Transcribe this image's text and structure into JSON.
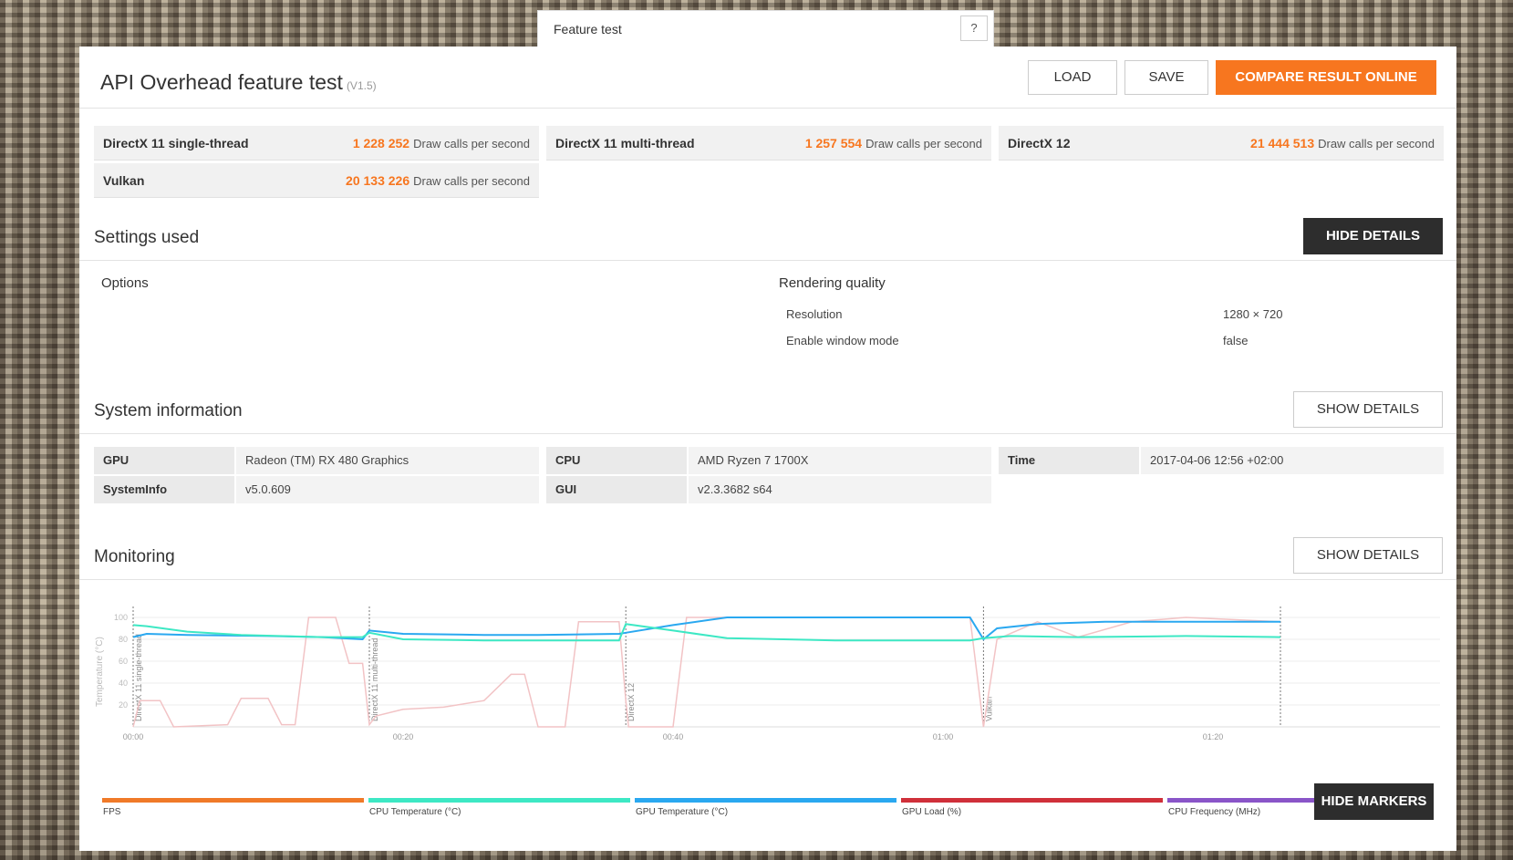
{
  "window": {
    "title": "Feature test",
    "help": "?"
  },
  "header": {
    "title": "API Overhead feature test",
    "version": "(V1.5)"
  },
  "toolbar": {
    "load": "LOAD",
    "save": "SAVE",
    "compare": "COMPARE RESULT ONLINE"
  },
  "scores": [
    {
      "name": "DirectX 11 single-thread",
      "value": "1 228 252",
      "unit": "Draw calls per second"
    },
    {
      "name": "DirectX 11 multi-thread",
      "value": "1 257 554",
      "unit": "Draw calls per second"
    },
    {
      "name": "DirectX 12",
      "value": "21 444 513",
      "unit": "Draw calls per second"
    },
    {
      "name": "Vulkan",
      "value": "20 133 226",
      "unit": "Draw calls per second"
    }
  ],
  "settings": {
    "title": "Settings used",
    "button": "HIDE DETAILS",
    "options_label": "Options",
    "rendering_label": "Rendering quality",
    "rows": [
      {
        "key": "Resolution",
        "value": "1280 × 720"
      },
      {
        "key": "Enable window mode",
        "value": "false"
      }
    ]
  },
  "sysinfo": {
    "title": "System information",
    "button": "SHOW DETAILS",
    "rows": [
      {
        "key": "GPU",
        "value": "Radeon (TM) RX 480 Graphics"
      },
      {
        "key": "CPU",
        "value": "AMD Ryzen 7 1700X"
      },
      {
        "key": "Time",
        "value": "2017-04-06 12:56 +02:00"
      },
      {
        "key": "SystemInfo",
        "value": "v5.0.609"
      },
      {
        "key": "GUI",
        "value": "v2.3.3682 s64"
      }
    ]
  },
  "monitoring": {
    "title": "Monitoring",
    "button": "SHOW DETAILS",
    "markers_button": "HIDE MARKERS",
    "legend": [
      {
        "label": "FPS",
        "color": "#f07a28"
      },
      {
        "label": "CPU Temperature (°C)",
        "color": "#3de8c4"
      },
      {
        "label": "GPU Temperature (°C)",
        "color": "#2aa8f0"
      },
      {
        "label": "GPU Load (%)",
        "color": "#d0303a"
      },
      {
        "label": "CPU Frequency (MHz)",
        "color": "#8a55c8"
      }
    ]
  },
  "chart_data": {
    "type": "line",
    "ylabel": "Temperature (°C)",
    "ylim": [
      0,
      100
    ],
    "yticks": [
      "100",
      "80",
      "60",
      "40",
      "20"
    ],
    "xticks": [
      "00:00",
      "00:20",
      "00:40",
      "01:00",
      "01:20"
    ],
    "markers": [
      {
        "label": "DirectX 11 single-thread",
        "t": 0
      },
      {
        "label": "DirectX 11 multi-thread",
        "t": 17.5
      },
      {
        "label": "DirectX 12",
        "t": 36.5
      },
      {
        "label": "Vulkan",
        "t": 63
      },
      {
        "end": 85
      }
    ],
    "series": [
      {
        "name": "CPU Temperature (°C)",
        "color": "#3de8c4",
        "points": [
          [
            0,
            93
          ],
          [
            1,
            92
          ],
          [
            4,
            87
          ],
          [
            8,
            84
          ],
          [
            14,
            82
          ],
          [
            17,
            82
          ],
          [
            17.5,
            86
          ],
          [
            20,
            80
          ],
          [
            26,
            79
          ],
          [
            32,
            79
          ],
          [
            36,
            79
          ],
          [
            36.5,
            94
          ],
          [
            40,
            88
          ],
          [
            44,
            81
          ],
          [
            52,
            79
          ],
          [
            62,
            79
          ],
          [
            63,
            81
          ],
          [
            65,
            83
          ],
          [
            70,
            82
          ],
          [
            78,
            83
          ],
          [
            85,
            82
          ]
        ]
      },
      {
        "name": "GPU Temperature (°C)",
        "color": "#2aa8f0",
        "points": [
          [
            0,
            82
          ],
          [
            1,
            85
          ],
          [
            4,
            84
          ],
          [
            10,
            83
          ],
          [
            14,
            82
          ],
          [
            17,
            80
          ],
          [
            17.5,
            88
          ],
          [
            20,
            85
          ],
          [
            26,
            84
          ],
          [
            30,
            84
          ],
          [
            36,
            85
          ],
          [
            36.5,
            86
          ],
          [
            40,
            93
          ],
          [
            44,
            100
          ],
          [
            62,
            100
          ],
          [
            63,
            80
          ],
          [
            64,
            90
          ],
          [
            67,
            94
          ],
          [
            72,
            96
          ],
          [
            85,
            96
          ]
        ]
      },
      {
        "name": "GPU Load (%)",
        "color": "#f2c3c5",
        "points": [
          [
            0,
            0
          ],
          [
            0.5,
            24
          ],
          [
            2,
            24
          ],
          [
            3,
            0
          ],
          [
            7,
            2
          ],
          [
            8,
            26
          ],
          [
            10,
            26
          ],
          [
            11,
            2
          ],
          [
            12,
            2
          ],
          [
            13,
            100
          ],
          [
            15,
            100
          ],
          [
            16,
            58
          ],
          [
            17,
            58
          ],
          [
            17.5,
            2
          ],
          [
            18,
            10
          ],
          [
            20,
            16
          ],
          [
            23,
            18
          ],
          [
            26,
            24
          ],
          [
            28,
            48
          ],
          [
            29,
            48
          ],
          [
            30,
            0
          ],
          [
            32,
            0
          ],
          [
            33,
            96
          ],
          [
            36,
            96
          ],
          [
            36.5,
            24
          ],
          [
            36.7,
            0
          ],
          [
            40,
            0
          ],
          [
            41,
            100
          ],
          [
            44,
            100
          ],
          [
            62,
            100
          ],
          [
            63,
            0
          ],
          [
            64,
            80
          ],
          [
            67,
            96
          ],
          [
            70,
            82
          ],
          [
            74,
            96
          ],
          [
            78,
            100
          ],
          [
            85,
            96
          ]
        ]
      }
    ]
  }
}
